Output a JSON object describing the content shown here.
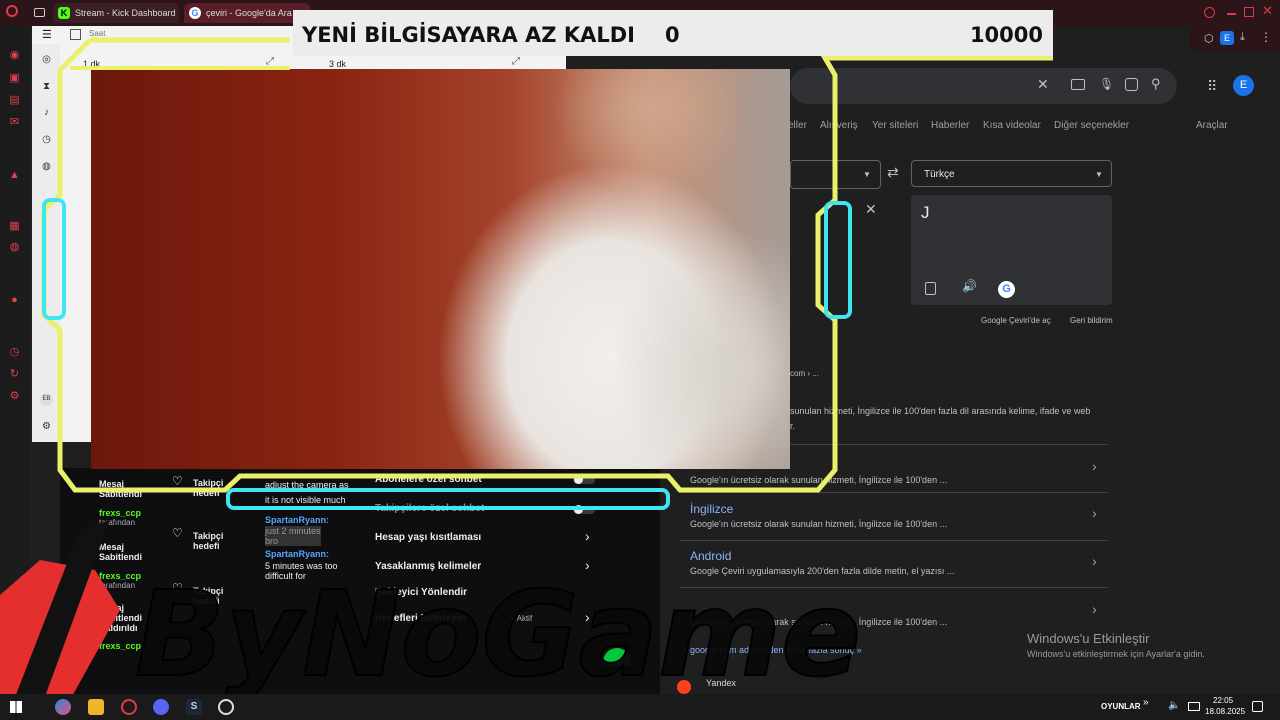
{
  "browser": {
    "tabs": [
      {
        "label": "Stream - Kick Dashboard",
        "icon": "kick-icon"
      },
      {
        "label": "çeviri - Google'da Ara",
        "icon": "google-icon"
      }
    ],
    "profile_initial": "E"
  },
  "clock_app": {
    "title": "Saat",
    "timer_1": "1 dk",
    "timer_2": "3 dk",
    "initials": "EB"
  },
  "overlay": {
    "goal_label": "YENİ BİLGİSAYARA AZ KALDI",
    "goal_current": "0",
    "goal_target": "10000",
    "watermark": "ByNoGame",
    "frame_color": "#eaf06a",
    "accent_color": "#3fe6f0"
  },
  "google": {
    "nav": [
      "eller",
      "Alışveriş",
      "Yer siteleri",
      "Haberler",
      "Kısa videolar",
      "Diğer seçenekler",
      "Araçlar"
    ],
    "target_language": "Türkçe",
    "output_text": "J",
    "open_translate": "Google Çeviri'de aç",
    "feedback": "Geri bildirim",
    "snippet_crumb": "com › ...",
    "snippet_1": "sunulan hizmeti, İngilizce ile 100'den fazla dil arasında kelime, ifade ve web",
    "snippet_1b": "r.",
    "results": [
      {
        "title": "",
        "desc": "Google'ın ücretsiz olarak sunulan hizmeti, İngilizce ile 100'den ..."
      },
      {
        "title": "İngilizce",
        "desc": "Google'ın ücretsiz olarak sunulan hizmeti, İngilizce ile 100'den ..."
      },
      {
        "title": "Android",
        "desc": "Google Çeviri uygulamasıyla 200'den fazla dilde metin, el yazısı ..."
      },
      {
        "title": "",
        "desc": "Google'ın ücretsiz olarak sunulan hizmeti, İngilizce ile 100'den ..."
      }
    ],
    "more_results": "google.com adresinden daha fazla sonuç »",
    "next_site": "Yandex"
  },
  "chat": {
    "pinned": [
      {
        "label": "Mesaj Sabitlendi",
        "by": "frexs_ccp",
        "by_suffix": "tarafından"
      },
      {
        "label": "Mesaj Sabitlendi",
        "by": "frexs_ccp",
        "by_suffix": "tarafından"
      },
      {
        "label": "Mesaj Sabitlendi Kaldırıldı",
        "by": "frexs_ccp",
        "by_suffix": ""
      }
    ],
    "follow_items": [
      "Takipçi hedefi",
      "Takipçi hedefi",
      "Takipçi hedefi"
    ],
    "messages": [
      {
        "user": "",
        "text": "adjust the camera as"
      },
      {
        "user": "",
        "text": "it is not visible much"
      },
      {
        "user": "SpartanRyann:",
        "text": "just 2 minutes bro"
      },
      {
        "user": "SpartanRyann:",
        "text": "5 minutes was too difficult for"
      }
    ],
    "settings": [
      {
        "label": "Abonelere özel sohbet",
        "type": "toggle"
      },
      {
        "label": "Takipçilere özel sohbet",
        "type": "toggle"
      },
      {
        "label": "Hesap yaşı kısıtlaması",
        "type": "chevron"
      },
      {
        "label": "Yasaklanmış kelimeler",
        "type": "chevron"
      },
      {
        "label": "Bekleyici Yönlendir",
        "type": "none"
      },
      {
        "label": "Hedefleri Belirleyin",
        "type": "chevron",
        "status": "Aktif"
      }
    ]
  },
  "windows": {
    "activate_title": "Windows'u Etkinleştir",
    "activate_sub": "Windows'u etkinleştirmek için Ayarlar'a gidin.",
    "tray_label": "OYUNLAR",
    "time": "22:05",
    "date": "18.08.2025"
  }
}
